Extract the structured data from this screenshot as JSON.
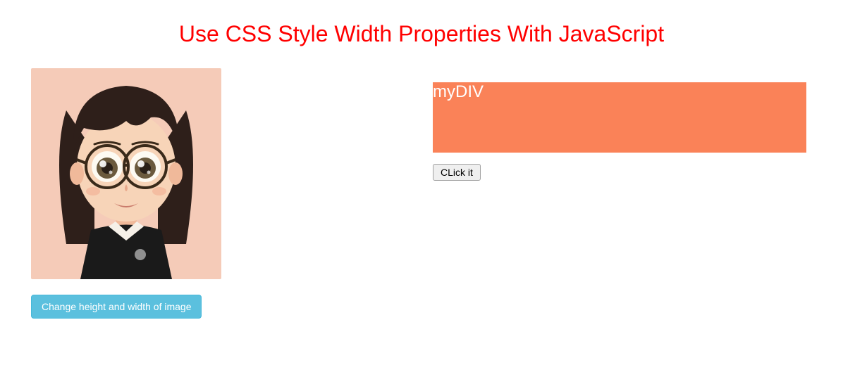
{
  "title": "Use CSS Style Width Properties With JavaScript",
  "left": {
    "change_button_label": "Change height and width of image"
  },
  "right": {
    "box_label": "myDIV",
    "click_button_label": "CLick it"
  }
}
